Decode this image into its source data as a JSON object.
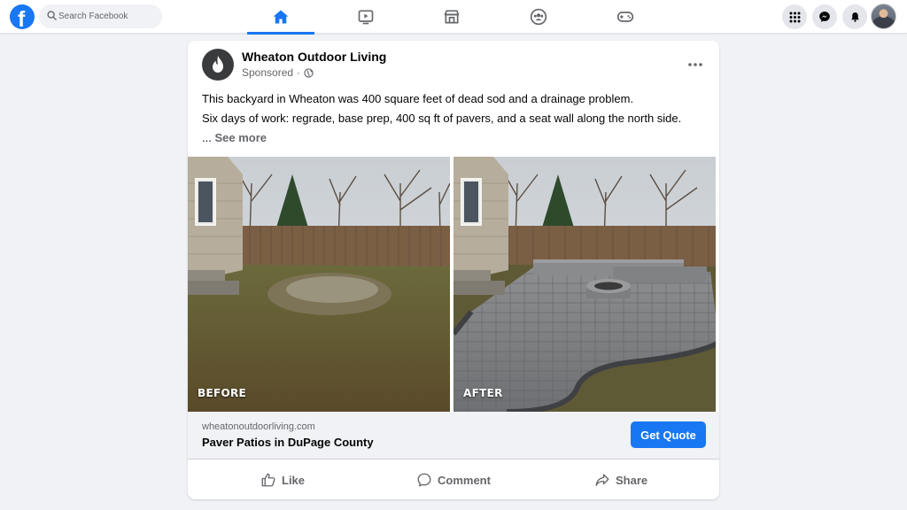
{
  "topbar": {
    "search_placeholder": "Search Facebook",
    "nav_tabs": [
      {
        "name": "home-icon",
        "active": true
      },
      {
        "name": "video-icon",
        "active": false
      },
      {
        "name": "marketplace-icon",
        "active": false
      },
      {
        "name": "groups-icon",
        "active": false
      },
      {
        "name": "gaming-icon",
        "active": false
      }
    ],
    "right_buttons": [
      "menu-grid-icon",
      "messenger-icon",
      "notifications-icon"
    ],
    "accent_color": "#1877f2"
  },
  "post": {
    "page_name": "Wheaton Outdoor Living",
    "sponsored": "Sponsored",
    "separator": "·",
    "body_lines": [
      "This backyard in Wheaton was 400 square feet of dead sod and a drainage problem.",
      "Six days of work: regrade, base prep, 400 sq ft of pavers, and a seat wall along the north side."
    ],
    "see_more_dots": "...",
    "see_more": "See more",
    "photos": [
      {
        "label": "BEFORE"
      },
      {
        "label": "AFTER"
      }
    ],
    "link": {
      "domain": "wheatonoutdoorliving.com",
      "headline": "Paver Patios in DuPage County",
      "cta": "Get Quote"
    },
    "actions": {
      "like": "Like",
      "comment": "Comment",
      "share": "Share"
    }
  }
}
